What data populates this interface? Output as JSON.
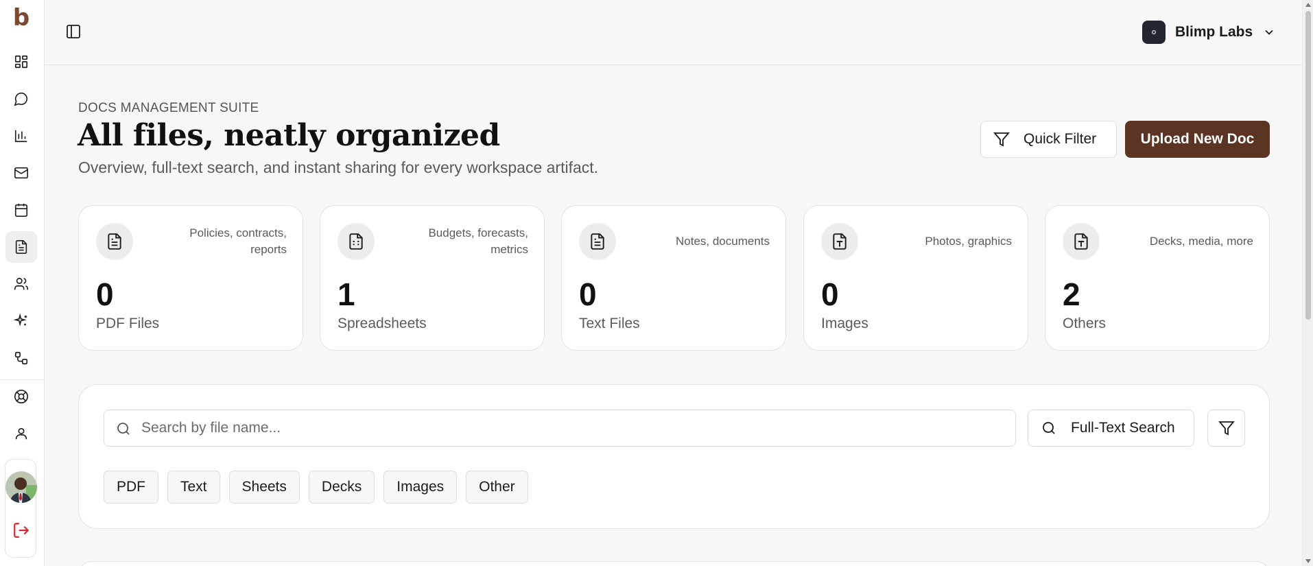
{
  "app": {
    "logo_letter": "b"
  },
  "sidebar": {
    "items": [
      {
        "name": "dashboard",
        "icon": "layout-grid-icon"
      },
      {
        "name": "chat",
        "icon": "message-circle-icon"
      },
      {
        "name": "reports",
        "icon": "chart-bars-icon"
      },
      {
        "name": "mail",
        "icon": "mail-icon"
      },
      {
        "name": "calendar",
        "icon": "calendar-icon"
      },
      {
        "name": "docs",
        "icon": "document-icon",
        "active": true
      },
      {
        "name": "team",
        "icon": "users-icon"
      },
      {
        "name": "ai",
        "icon": "sparkles-icon"
      },
      {
        "name": "workflows",
        "icon": "workflow-icon"
      },
      {
        "name": "support",
        "icon": "lifebuoy-icon"
      },
      {
        "name": "profile",
        "icon": "user-icon"
      }
    ],
    "logout_icon": "logout-icon"
  },
  "topbar": {
    "workspace_name": "Blimp Labs"
  },
  "header": {
    "eyebrow": "DOCS MANAGEMENT SUITE",
    "title": "All files, neatly organized",
    "subtitle": "Overview, full-text search, and instant sharing for every workspace artifact.",
    "quick_filter_label": "Quick Filter",
    "upload_label": "Upload New Doc"
  },
  "stats": [
    {
      "description": "Policies, contracts, reports",
      "count": "0",
      "label": "PDF Files",
      "icon": "file-text-icon"
    },
    {
      "description": "Budgets, forecasts, metrics",
      "count": "1",
      "label": "Spreadsheets",
      "icon": "file-spreadsheet-icon"
    },
    {
      "description": "Notes, documents",
      "count": "0",
      "label": "Text Files",
      "icon": "file-text-icon"
    },
    {
      "description": "Photos, graphics",
      "count": "0",
      "label": "Images",
      "icon": "file-type-icon"
    },
    {
      "description": "Decks, media, more",
      "count": "2",
      "label": "Others",
      "icon": "file-type-icon"
    }
  ],
  "search": {
    "placeholder": "Search by file name...",
    "value": "",
    "full_text_label": "Full-Text Search",
    "chips": [
      "PDF",
      "Text",
      "Sheets",
      "Decks",
      "Images",
      "Other"
    ]
  },
  "colors": {
    "brand": "#7a4a30",
    "primary_button": "#5c3424",
    "background": "#f7f7f7",
    "logout": "#d6262f"
  }
}
